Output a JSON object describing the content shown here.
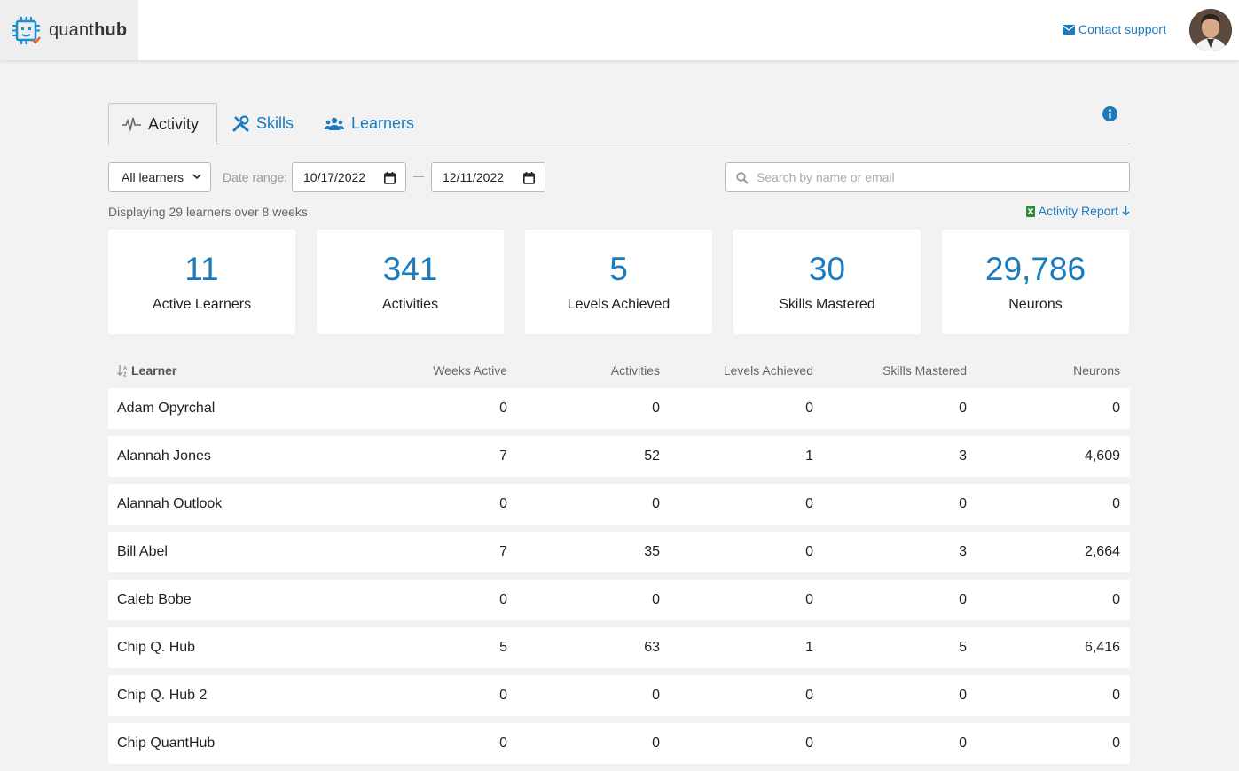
{
  "header": {
    "logo_prefix": "quant",
    "logo_suffix": "hub",
    "support_label": "Contact support"
  },
  "tabs": [
    {
      "label": "Activity",
      "icon": "pulse-icon",
      "active": true
    },
    {
      "label": "Skills",
      "icon": "tools-icon",
      "active": false
    },
    {
      "label": "Learners",
      "icon": "users-icon",
      "active": false
    }
  ],
  "filters": {
    "learner_select": "All learners",
    "date_range_label": "Date range:",
    "date_start": "10/17/2022",
    "date_end": "12/11/2022",
    "search_placeholder": "Search by name or email"
  },
  "summary": {
    "display_text": "Displaying 29 learners over 8 weeks",
    "report_label": "Activity Report"
  },
  "stats": [
    {
      "value": "11",
      "label": "Active Learners"
    },
    {
      "value": "341",
      "label": "Activities"
    },
    {
      "value": "5",
      "label": "Levels Achieved"
    },
    {
      "value": "30",
      "label": "Skills Mastered"
    },
    {
      "value": "29,786",
      "label": "Neurons"
    }
  ],
  "table": {
    "columns": [
      "Learner",
      "Weeks Active",
      "Activities",
      "Levels Achieved",
      "Skills Mastered",
      "Neurons"
    ],
    "rows": [
      [
        "Adam Opyrchal",
        "0",
        "0",
        "0",
        "0",
        "0"
      ],
      [
        "Alannah Jones",
        "7",
        "52",
        "1",
        "3",
        "4,609"
      ],
      [
        "Alannah Outlook",
        "0",
        "0",
        "0",
        "0",
        "0"
      ],
      [
        "Bill Abel",
        "7",
        "35",
        "0",
        "3",
        "2,664"
      ],
      [
        "Caleb Bobe",
        "0",
        "0",
        "0",
        "0",
        "0"
      ],
      [
        "Chip Q. Hub",
        "5",
        "63",
        "1",
        "5",
        "6,416"
      ],
      [
        "Chip Q. Hub 2",
        "0",
        "0",
        "0",
        "0",
        "0"
      ],
      [
        "Chip QuantHub",
        "0",
        "0",
        "0",
        "0",
        "0"
      ]
    ]
  },
  "colors": {
    "accent": "#1a7bbf",
    "background": "#f2f2f2",
    "excel_green": "#2e8b3a"
  }
}
